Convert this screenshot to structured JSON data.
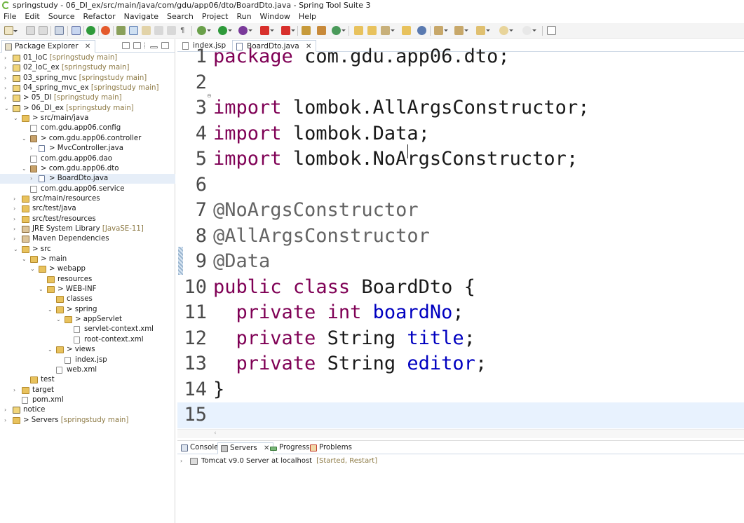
{
  "window": {
    "title": "springstudy - 06_DI_ex/src/main/java/com/gdu/app06/dto/BoardDto.java - Spring Tool Suite 3"
  },
  "menu": [
    "File",
    "Edit",
    "Source",
    "Refactor",
    "Navigate",
    "Search",
    "Project",
    "Run",
    "Window",
    "Help"
  ],
  "explorer": {
    "tab_label": "Package Explorer",
    "tree": [
      {
        "label": "01_IoC",
        "dec": "[springstudy main]",
        "icon": "project-icon"
      },
      {
        "label": "02_IoC_ex",
        "dec": "[springstudy main]",
        "icon": "project-icon"
      },
      {
        "label": "03_spring_mvc",
        "dec": "[springstudy main]",
        "icon": "project-icon"
      },
      {
        "label": "04_spring_mvc_ex",
        "dec": "[springstudy main]",
        "icon": "project-icon"
      },
      {
        "label": "> 05_DI",
        "dec": "[springstudy main]",
        "icon": "project-icon"
      },
      {
        "label": "> 06_DI_ex",
        "dec": "[springstudy main]",
        "icon": "project-icon"
      },
      {
        "label": "> src/main/java",
        "dec": "",
        "icon": "source-folder-icon"
      },
      {
        "label": "com.gdu.app06.config",
        "dec": "",
        "icon": "empty-package-icon"
      },
      {
        "label": "> com.gdu.app06.controller",
        "dec": "",
        "icon": "package-icon"
      },
      {
        "label": "> MvcController.java",
        "dec": "",
        "icon": "java-file-icon"
      },
      {
        "label": "com.gdu.app06.dao",
        "dec": "",
        "icon": "empty-package-icon"
      },
      {
        "label": "> com.gdu.app06.dto",
        "dec": "",
        "icon": "package-icon"
      },
      {
        "label": "> BoardDto.java",
        "dec": "",
        "icon": "java-file-icon"
      },
      {
        "label": "com.gdu.app06.service",
        "dec": "",
        "icon": "empty-package-icon"
      },
      {
        "label": "src/main/resources",
        "dec": "",
        "icon": "source-folder-icon"
      },
      {
        "label": "src/test/java",
        "dec": "",
        "icon": "source-folder-icon"
      },
      {
        "label": "src/test/resources",
        "dec": "",
        "icon": "source-folder-icon"
      },
      {
        "label": "JRE System Library",
        "dec": "[JavaSE-11]",
        "icon": "library-icon"
      },
      {
        "label": "Maven Dependencies",
        "dec": "",
        "icon": "library-icon"
      },
      {
        "label": "> src",
        "dec": "",
        "icon": "folder-icon"
      },
      {
        "label": "> main",
        "dec": "",
        "icon": "folder-icon"
      },
      {
        "label": "> webapp",
        "dec": "",
        "icon": "folder-icon"
      },
      {
        "label": "resources",
        "dec": "",
        "icon": "folder-icon"
      },
      {
        "label": "> WEB-INF",
        "dec": "",
        "icon": "folder-icon"
      },
      {
        "label": "classes",
        "dec": "",
        "icon": "folder-icon"
      },
      {
        "label": "> spring",
        "dec": "",
        "icon": "folder-icon"
      },
      {
        "label": "> appServlet",
        "dec": "",
        "icon": "folder-icon"
      },
      {
        "label": "servlet-context.xml",
        "dec": "",
        "icon": "xml-file-icon"
      },
      {
        "label": "root-context.xml",
        "dec": "",
        "icon": "xml-file-icon"
      },
      {
        "label": "> views",
        "dec": "",
        "icon": "folder-icon"
      },
      {
        "label": "index.jsp",
        "dec": "",
        "icon": "jsp-file-icon"
      },
      {
        "label": "web.xml",
        "dec": "",
        "icon": "xml-file-icon"
      },
      {
        "label": "test",
        "dec": "",
        "icon": "folder-icon"
      },
      {
        "label": "target",
        "dec": "",
        "icon": "folder-icon"
      },
      {
        "label": "pom.xml",
        "dec": "",
        "icon": "xml-file-icon"
      },
      {
        "label": "notice",
        "dec": "",
        "icon": "project-icon"
      },
      {
        "label": "> Servers",
        "dec": "[springstudy main]",
        "icon": "folder-icon"
      }
    ]
  },
  "editor": {
    "tabs": [
      "index.jsp",
      "BoardDto.java"
    ],
    "active_tab": "BoardDto.java",
    "lines": [
      {
        "n": "1",
        "tokens": [
          [
            "kw",
            "package"
          ],
          [
            "",
            "com.gdu.app06.dto;"
          ]
        ]
      },
      {
        "n": "2",
        "tokens": []
      },
      {
        "n": "3",
        "tokens": [
          [
            "kw",
            "import"
          ],
          [
            "",
            "lombok.AllArgsConstructor;"
          ]
        ]
      },
      {
        "n": "4",
        "tokens": [
          [
            "kw",
            "import"
          ],
          [
            "",
            "lombok.Data;"
          ]
        ]
      },
      {
        "n": "5",
        "tokens": [
          [
            "kw",
            "import"
          ],
          [
            "",
            "lombok.NoArgsConstructor;"
          ]
        ]
      },
      {
        "n": "6",
        "tokens": []
      },
      {
        "n": "7",
        "tokens": [
          [
            "ann",
            "@NoArgsConstructor"
          ]
        ]
      },
      {
        "n": "8",
        "tokens": [
          [
            "ann",
            "@AllArgsConstructor"
          ]
        ]
      },
      {
        "n": "9",
        "tokens": [
          [
            "ann",
            "@Data"
          ]
        ]
      },
      {
        "n": "10",
        "tokens": [
          [
            "kw",
            "public"
          ],
          [
            "kw",
            "class"
          ],
          [
            "",
            "BoardDto {"
          ]
        ]
      },
      {
        "n": "11",
        "tokens": [
          [
            "kw",
            "  private"
          ],
          [
            "kw",
            "int"
          ],
          [
            "fld",
            "boardNo"
          ],
          [
            "",
            ";"
          ]
        ]
      },
      {
        "n": "12",
        "tokens": [
          [
            "kw",
            "  private"
          ],
          [
            "",
            "String"
          ],
          [
            "fld",
            "title"
          ],
          [
            "",
            ";"
          ]
        ]
      },
      {
        "n": "13",
        "tokens": [
          [
            "kw",
            "  private"
          ],
          [
            "",
            "String"
          ],
          [
            "fld",
            "editor"
          ],
          [
            "",
            ";"
          ]
        ]
      },
      {
        "n": "14",
        "tokens": [
          [
            "",
            "}"
          ]
        ]
      },
      {
        "n": "15",
        "tokens": []
      }
    ]
  },
  "bottom": {
    "tabs": [
      "Console",
      "Servers",
      "Progress",
      "Problems"
    ],
    "active_tab": "Servers",
    "server_row": {
      "label": "Tomcat v9.0 Server at localhost",
      "status": "[Started, Restart]"
    }
  }
}
